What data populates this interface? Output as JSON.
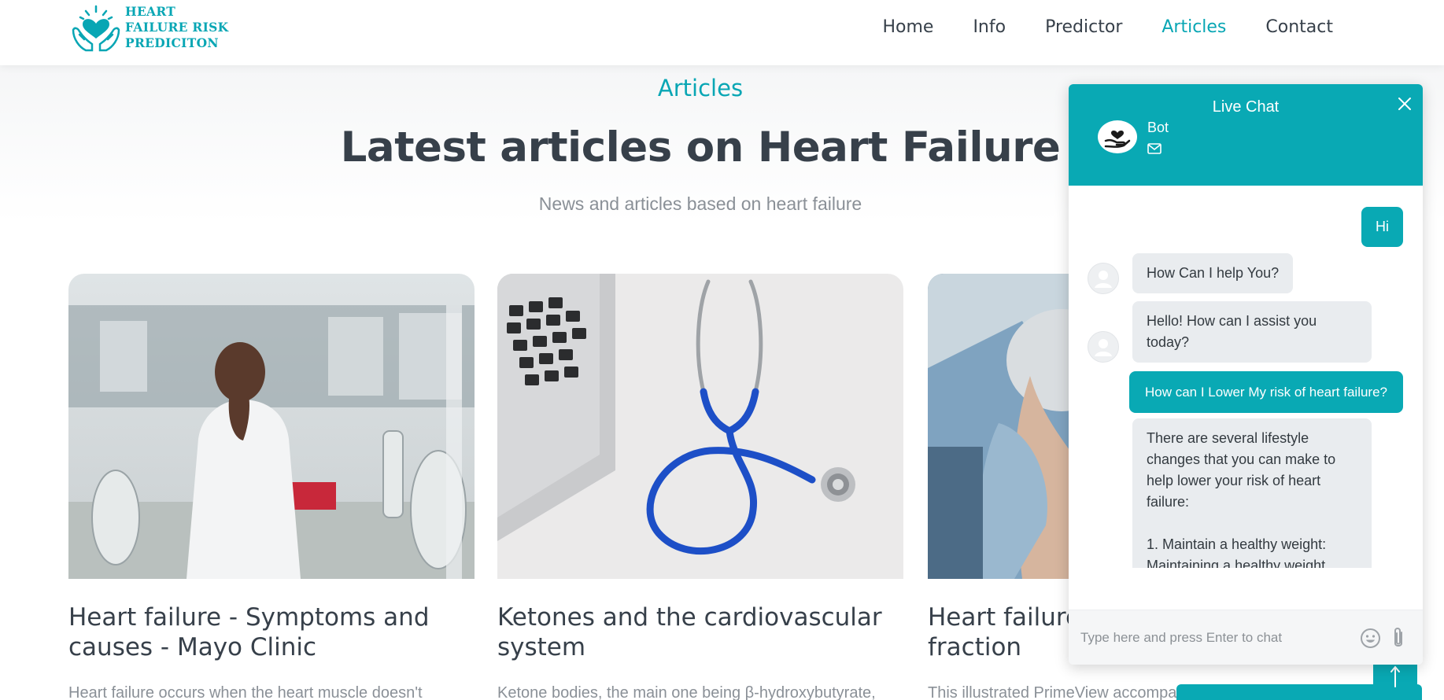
{
  "logo": {
    "line1": "HEART",
    "line2": "FAILURE RISK",
    "line3": "PREDICITON"
  },
  "nav": {
    "items": [
      {
        "label": "Home"
      },
      {
        "label": "Info"
      },
      {
        "label": "Predictor"
      },
      {
        "label": "Articles"
      },
      {
        "label": "Contact"
      }
    ],
    "active": "Articles"
  },
  "section": {
    "tag": "Articles",
    "title": "Latest articles on Heart Failure",
    "subtitle": "News and articles based on heart failure"
  },
  "articles": [
    {
      "title": "Heart failure - Symptoms and causes - Mayo Clinic",
      "excerpt": "Heart failure occurs when the heart muscle doesn't",
      "image": "lab-researcher-photo"
    },
    {
      "title": "Ketones and the cardiovascular system",
      "excerpt": "Ketone bodies, the main one being β-hydroxybutyrate,",
      "image": "stethoscope-laptop-photo"
    },
    {
      "title": "Heart failure reduced ejection fraction",
      "excerpt": "This illustrated PrimeView accompanies",
      "image": "surgeons-operating-photo"
    }
  ],
  "chat": {
    "header_title": "Live Chat",
    "bot_name": "Bot",
    "messages": [
      {
        "from": "user",
        "text": "Hi"
      },
      {
        "from": "bot",
        "text": "How Can I help You?"
      },
      {
        "from": "bot",
        "text": "Hello! How can I assist you today?"
      },
      {
        "from": "user",
        "text": "How can I Lower My risk of heart failure?"
      },
      {
        "from": "bot",
        "text": "There are several lifestyle changes that you can make to help lower your risk of heart failure:\n\n1. Maintain a healthy weight: Maintaining a healthy weight"
      }
    ],
    "input_placeholder": "Type here and press Enter to chat"
  },
  "colors": {
    "brand": "#09a9b4",
    "text_dark": "#37404a",
    "text_muted": "#8a9097",
    "bubble_bot": "#e9ecef"
  }
}
